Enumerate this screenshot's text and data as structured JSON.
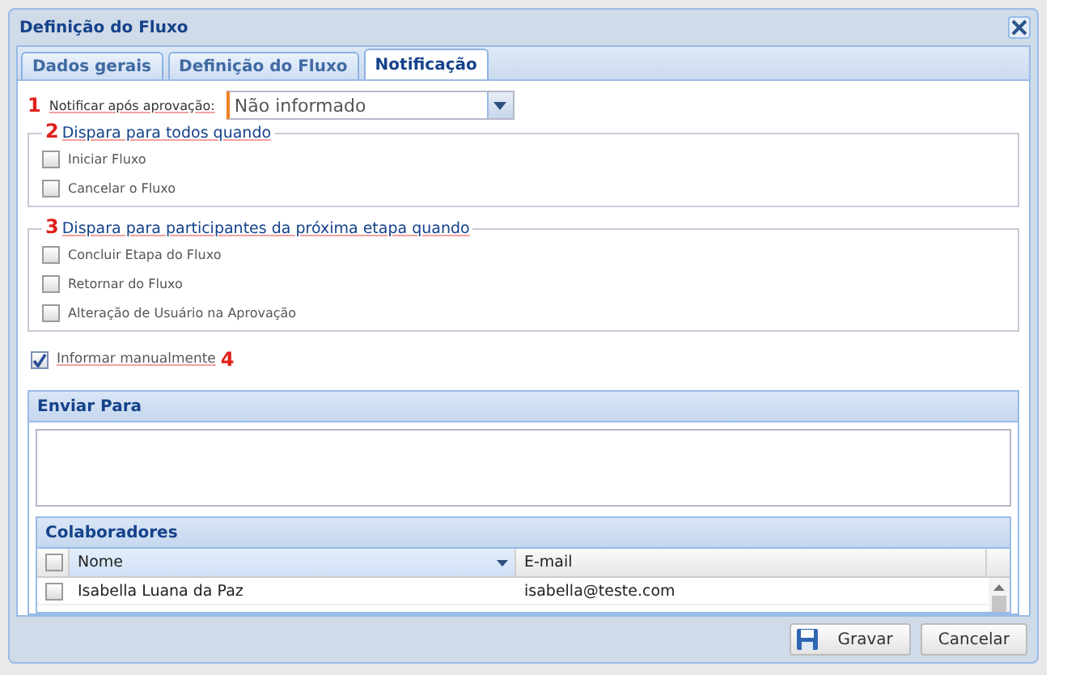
{
  "window": {
    "title": "Definição do Fluxo"
  },
  "tabs": [
    {
      "label": "Dados gerais",
      "selected": false
    },
    {
      "label": "Definição do Fluxo",
      "selected": false
    },
    {
      "label": "Notificação",
      "selected": true
    }
  ],
  "notify_field": {
    "marker": "1",
    "label": "Notificar após aprovação:",
    "value": "Não informado"
  },
  "groups": [
    {
      "marker": "2",
      "title": "Dispara para todos quando",
      "options": [
        {
          "label": "Iniciar Fluxo",
          "checked": false
        },
        {
          "label": "Cancelar o Fluxo",
          "checked": false
        }
      ]
    },
    {
      "marker": "3",
      "title": "Dispara para participantes da próxima etapa quando",
      "options": [
        {
          "label": "Concluir Etapa do Fluxo",
          "checked": false
        },
        {
          "label": "Retornar do Fluxo",
          "checked": false
        },
        {
          "label": "Alteração de Usuário na Aprovação",
          "checked": false
        }
      ]
    }
  ],
  "manual": {
    "label": "Informar manualmente",
    "marker": "4",
    "checked": true
  },
  "send_to": {
    "title": "Enviar Para"
  },
  "collaborators": {
    "title": "Colaboradores",
    "all_checked": false,
    "columns": [
      "Nome",
      "E-mail"
    ],
    "rows": [
      {
        "checked": false,
        "name": "Isabella Luana da Paz",
        "email": "isabella@teste.com"
      }
    ]
  },
  "buttons": [
    {
      "label": "Gravar",
      "kind": "save"
    },
    {
      "label": "Cancelar",
      "kind": "plain"
    }
  ]
}
